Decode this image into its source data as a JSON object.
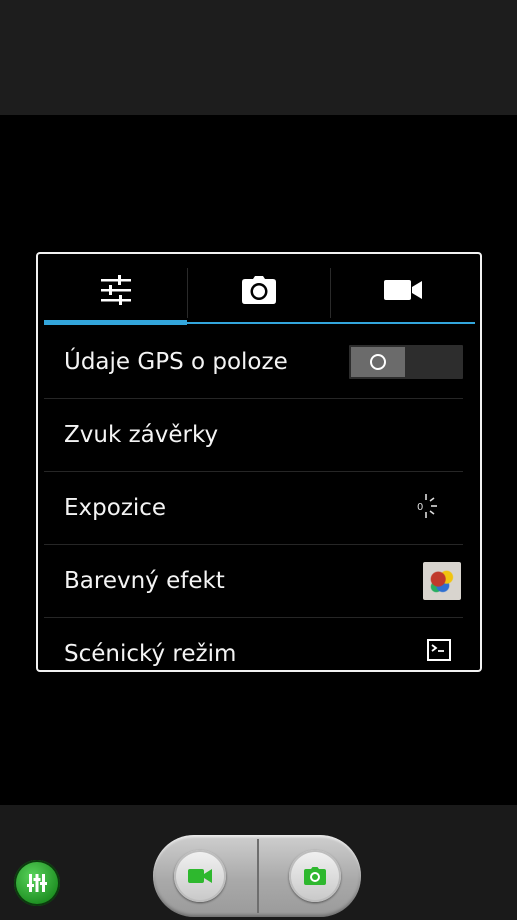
{
  "tabs": [
    {
      "icon": "sliders-icon",
      "selected": true
    },
    {
      "icon": "camera-icon",
      "selected": false
    },
    {
      "icon": "video-camera-icon",
      "selected": false
    }
  ],
  "settings": {
    "gps": {
      "label": "Údaje GPS o poloze",
      "toggle_on": false
    },
    "shutter_sound": {
      "label": "Zvuk závěrky"
    },
    "exposure": {
      "label": "Expozice",
      "value": "0"
    },
    "color_effect": {
      "label": "Barevný efekt"
    },
    "scene_mode": {
      "label": "Scénický režim"
    }
  },
  "colors": {
    "accent": "#33a6dc",
    "toggle_bg": "#2d2d2d",
    "mode_icon": "#2eb82e"
  },
  "bottom": {
    "settings_icon": "equalizer-icon",
    "video_mode_icon": "video-camera-icon",
    "photo_mode_icon": "camera-icon"
  }
}
